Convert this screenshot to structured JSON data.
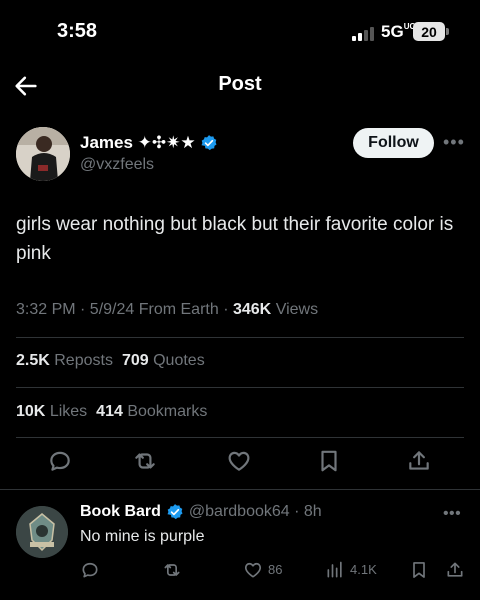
{
  "status": {
    "time": "3:58",
    "network": "5G",
    "network_suffix": "UC",
    "battery": "20"
  },
  "nav": {
    "title": "Post"
  },
  "author": {
    "name": "James ✦✣✷★",
    "handle": "@vxzfeels",
    "follow_label": "Follow"
  },
  "tweet": {
    "text": "girls wear nothing but black but their favorite color is pink",
    "timestamp": "3:32 PM · 5/9/24 From Earth ·",
    "views_count": "346K",
    "views_label": "Views"
  },
  "stats": {
    "reposts_count": "2.5K",
    "reposts_label": "Reposts",
    "quotes_count": "709",
    "quotes_label": "Quotes",
    "likes_count": "10K",
    "likes_label": "Likes",
    "bookmarks_count": "414",
    "bookmarks_label": "Bookmarks"
  },
  "reply": {
    "name": "Book Bard",
    "handle_time": "@bardbook64 · 8h",
    "text": "No mine is purple",
    "likes": "86",
    "views": "4.1K"
  },
  "colors": {
    "verified": "#1d9bf0",
    "muted": "#71767b",
    "divider": "#2f3336"
  },
  "icons": [
    "back-arrow-icon",
    "verified-icon",
    "more-icon",
    "reply-icon",
    "repost-icon",
    "like-icon",
    "bookmark-icon",
    "share-icon",
    "views-icon"
  ]
}
